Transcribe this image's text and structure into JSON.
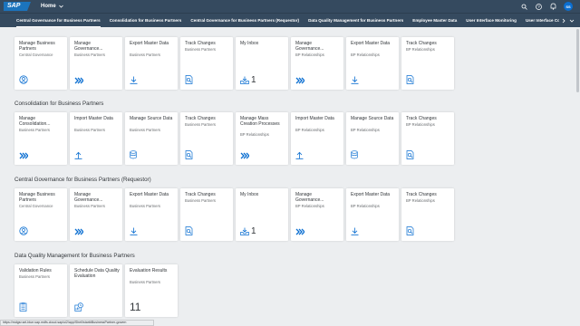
{
  "shell": {
    "logo": "SAP",
    "home_label": "Home",
    "avatar_initials": "SS"
  },
  "tabs": [
    "Central Governance for Business Partners",
    "Consolidation for Business Partners",
    "Central Governance for Business Partners (Requestor)",
    "Data Quality Management for Business Partners",
    "Employee Master Data",
    "User Interface Monitoring",
    "User Interface Configura"
  ],
  "sections": [
    {
      "title": "",
      "tiles": [
        {
          "title": "Manage Business Partners",
          "subtitle": "Central Governance",
          "icon": "person-icon"
        },
        {
          "title": "Manage Governance...",
          "subtitle": "Business Partners",
          "icon": "fast-forward-icon"
        },
        {
          "title": "Export Master Data",
          "subtitle": "Business Partners",
          "icon": "download-icon"
        },
        {
          "title": "Track Changes",
          "subtitle": "Business Partners",
          "icon": "search-document-icon"
        },
        {
          "title": "My Inbox",
          "subtitle": "",
          "icon": "inbox-icon",
          "count": "1"
        },
        {
          "title": "Manage Governance...",
          "subtitle": "BP Relationships",
          "icon": "fast-forward-icon"
        },
        {
          "title": "Export Master Data",
          "subtitle": "BP Relationships",
          "icon": "download-icon"
        },
        {
          "title": "Track Changes",
          "subtitle": "BP Relationships",
          "icon": "search-document-icon"
        }
      ]
    },
    {
      "title": "Consolidation for Business Partners",
      "tiles": [
        {
          "title": "Manage Consolidation...",
          "subtitle": "Business Partners",
          "icon": "fast-forward-icon"
        },
        {
          "title": "Import Master Data",
          "subtitle": "Business Partners",
          "icon": "upload-icon"
        },
        {
          "title": "Manage Source Data",
          "subtitle": "Business Partners",
          "icon": "database-icon"
        },
        {
          "title": "Track Changes",
          "subtitle": "Business Partners",
          "icon": "search-document-icon"
        },
        {
          "title": "Manage Mass Creation Processes",
          "subtitle": "BP Relationships",
          "icon": "fast-forward-icon"
        },
        {
          "title": "Import Master Data",
          "subtitle": "BP Relationships",
          "icon": "upload-icon"
        },
        {
          "title": "Manage Source Data",
          "subtitle": "BP Relationships",
          "icon": "database-icon"
        },
        {
          "title": "Track Changes",
          "subtitle": "BP Relationships",
          "icon": "search-document-icon"
        }
      ]
    },
    {
      "title": "Central Governance for Business Partners (Requestor)",
      "tiles": [
        {
          "title": "Manage Business Partners",
          "subtitle": "Central Governance",
          "icon": "person-icon"
        },
        {
          "title": "Manage Governance...",
          "subtitle": "Business Partners",
          "icon": "fast-forward-icon"
        },
        {
          "title": "Export Master Data",
          "subtitle": "Business Partners",
          "icon": "download-icon"
        },
        {
          "title": "Track Changes",
          "subtitle": "Business Partners",
          "icon": "search-document-icon"
        },
        {
          "title": "My Inbox",
          "subtitle": "",
          "icon": "inbox-icon",
          "count": "1"
        },
        {
          "title": "Manage Governance...",
          "subtitle": "BP Relationships",
          "icon": "fast-forward-icon"
        },
        {
          "title": "Export Master Data",
          "subtitle": "BP Relationships",
          "icon": "download-icon"
        },
        {
          "title": "Track Changes",
          "subtitle": "BP Relationships",
          "icon": "search-document-icon"
        }
      ]
    },
    {
      "title": "Data Quality Management for Business Partners",
      "tiles": [
        {
          "title": "Validation Rules",
          "subtitle": "Business Partners",
          "icon": "checklist-icon"
        },
        {
          "title": "Schedule Data Quality Evaluation",
          "subtitle": "",
          "icon": "schedule-icon"
        },
        {
          "title": "Evaluation Results",
          "subtitle": "Business Partners",
          "icon": "",
          "bignum": "11"
        }
      ]
    }
  ],
  "status_url": "https://mdgsr.sel-blue.sap.mdfs.cloud.sap/ui2/app/Shell/start#BusinessPartner-govern",
  "colors": {
    "shell": "#354a5f",
    "accent": "#0a6ed1",
    "icon": "#0a6ed1"
  }
}
